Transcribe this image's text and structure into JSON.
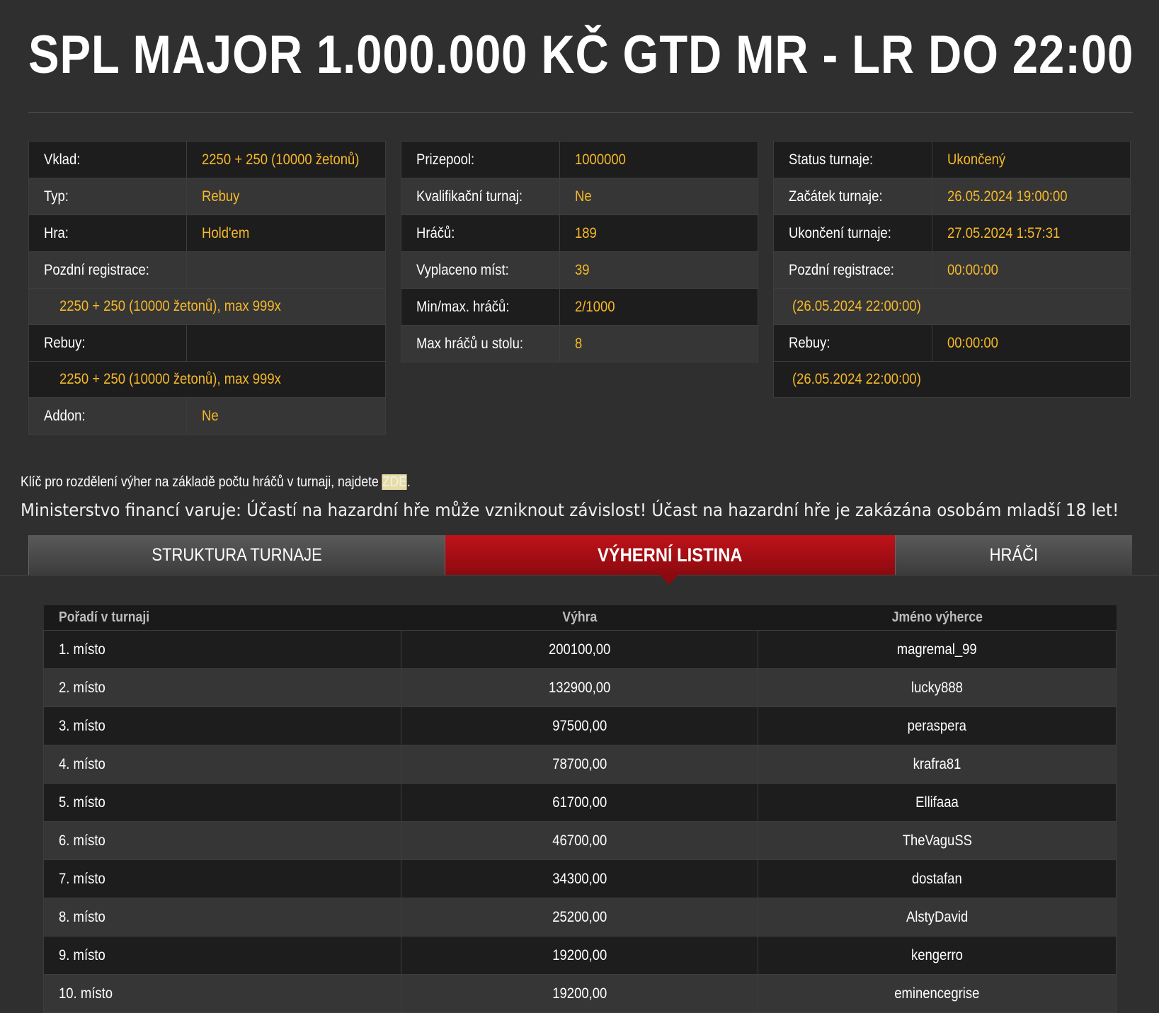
{
  "title": "SPL MAJOR 1.000.000 KČ GTD MR - LR DO 22:00",
  "info_left": {
    "deposit_label": "Vklad:",
    "deposit_value": "2250 + 250 (10000 žetonů)",
    "type_label": "Typ:",
    "type_value": "Rebuy",
    "game_label": "Hra:",
    "game_value": "Hold'em",
    "late_reg_label": "Pozdní registrace:",
    "late_reg_value": "2250 + 250 (10000 žetonů), max 999x",
    "rebuy_label": "Rebuy:",
    "rebuy_value": "2250 + 250 (10000 žetonů), max 999x",
    "addon_label": "Addon:",
    "addon_value": "Ne"
  },
  "info_mid": {
    "prizepool_label": "Prizepool:",
    "prizepool_value": "1000000",
    "qualifier_label": "Kvalifikační turnaj:",
    "qualifier_value": "Ne",
    "players_label": "Hráčů:",
    "players_value": "189",
    "paid_label": "Vyplaceno míst:",
    "paid_value": "39",
    "minmax_label": "Min/max. hráčů:",
    "minmax_value": "2/1000",
    "maxtable_label": "Max hráčů u stolu:",
    "maxtable_value": "8"
  },
  "info_right": {
    "status_label": "Status turnaje:",
    "status_value": "Ukončený",
    "start_label": "Začátek turnaje:",
    "start_value": "26.05.2024 19:00:00",
    "end_label": "Ukončení turnaje:",
    "end_value": "27.05.2024 1:57:31",
    "late_reg_label": "Pozdní registrace:",
    "late_reg_value": "00:00:00",
    "late_reg_date": "(26.05.2024 22:00:00)",
    "rebuy_label": "Rebuy:",
    "rebuy_value": "00:00:00",
    "rebuy_date": "(26.05.2024 22:00:00)"
  },
  "note": {
    "text": "Klíč pro rozdělení výher na základě počtu hráčů v turnaji, najdete ",
    "link": "ZDE",
    "end": "."
  },
  "warning": "Ministerstvo financí varuje: Účastí na hazardní hře může vzniknout závislost!  Účast na hazardní hře je zakázána osobám mladší 18 let!",
  "tabs": [
    "STRUKTURA TURNAJE",
    "VÝHERNÍ LISTINA",
    "HRÁČI"
  ],
  "prize_table": {
    "headers": [
      "Pořadí v turnaji",
      "Výhra",
      "Jméno výherce"
    ],
    "rows": [
      [
        "1. místo",
        "200100,00",
        "magremal_99"
      ],
      [
        "2. místo",
        "132900,00",
        "lucky888"
      ],
      [
        "3. místo",
        "97500,00",
        "peraspera"
      ],
      [
        "4. místo",
        "78700,00",
        "krafra81"
      ],
      [
        "5. místo",
        "61700,00",
        "Ellifaaa"
      ],
      [
        "6. místo",
        "46700,00",
        "TheVaguSS"
      ],
      [
        "7. místo",
        "34300,00",
        "dostafan"
      ],
      [
        "8. místo",
        "25200,00",
        "AlstyDavid"
      ],
      [
        "9. místo",
        "19200,00",
        "kengerro"
      ],
      [
        "10. místo",
        "19200,00",
        "eminencegrise"
      ]
    ]
  }
}
